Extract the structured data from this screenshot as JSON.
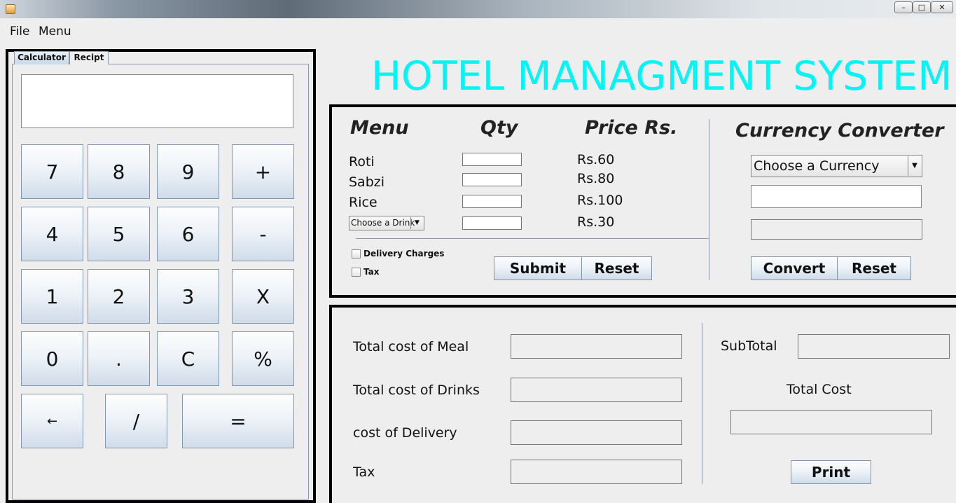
{
  "window": {
    "minimize_glyph": "–",
    "maximize_glyph": "□",
    "close_glyph": "✕"
  },
  "menubar": {
    "items": [
      {
        "label": "File"
      },
      {
        "label": "Menu"
      }
    ]
  },
  "tabs": [
    {
      "label": "Calculator",
      "selected": true
    },
    {
      "label": "Recipt",
      "selected": false
    }
  ],
  "calculator": {
    "display_value": "",
    "keys": [
      "7",
      "8",
      "9",
      "+",
      "4",
      "5",
      "6",
      "-",
      "1",
      "2",
      "3",
      "X",
      "0",
      ".",
      "C",
      "%",
      "←",
      "/",
      "="
    ]
  },
  "header": {
    "title": "HOTEL MANAGMENT SYSTEM",
    "title_color": "#00f5f5"
  },
  "order": {
    "col_menu": "Menu",
    "col_qty": "Qty",
    "col_price": "Price Rs.",
    "items": [
      {
        "name": "Roti",
        "qty": "",
        "price": "Rs.60"
      },
      {
        "name": "Sabzi",
        "qty": "",
        "price": "Rs.80"
      },
      {
        "name": "Rice",
        "qty": "",
        "price": "Rs.100"
      }
    ],
    "drink": {
      "selected": "Choose a Drink",
      "qty": "",
      "price": "Rs.30"
    },
    "delivery_charges_label": "Delivery Charges",
    "delivery_checked": false,
    "tax_label": "Tax",
    "tax_checked": false,
    "submit_label": "Submit",
    "reset_label": "Reset"
  },
  "currency": {
    "title": "Currency Converter",
    "selected": "Choose a Currency",
    "input_value": "",
    "output_value": "",
    "convert_label": "Convert",
    "reset_label": "Reset"
  },
  "totals": {
    "meal_label": "Total cost of Meal",
    "meal_value": "",
    "drinks_label": "Total cost of Drinks",
    "drinks_value": "",
    "delivery_label": "cost of Delivery",
    "delivery_value": "",
    "tax_label": "Tax",
    "tax_value": "",
    "subtotal_label": "SubTotal",
    "subtotal_value": "",
    "total_cost_label": "Total Cost",
    "total_cost_value": "",
    "print_label": "Print"
  }
}
